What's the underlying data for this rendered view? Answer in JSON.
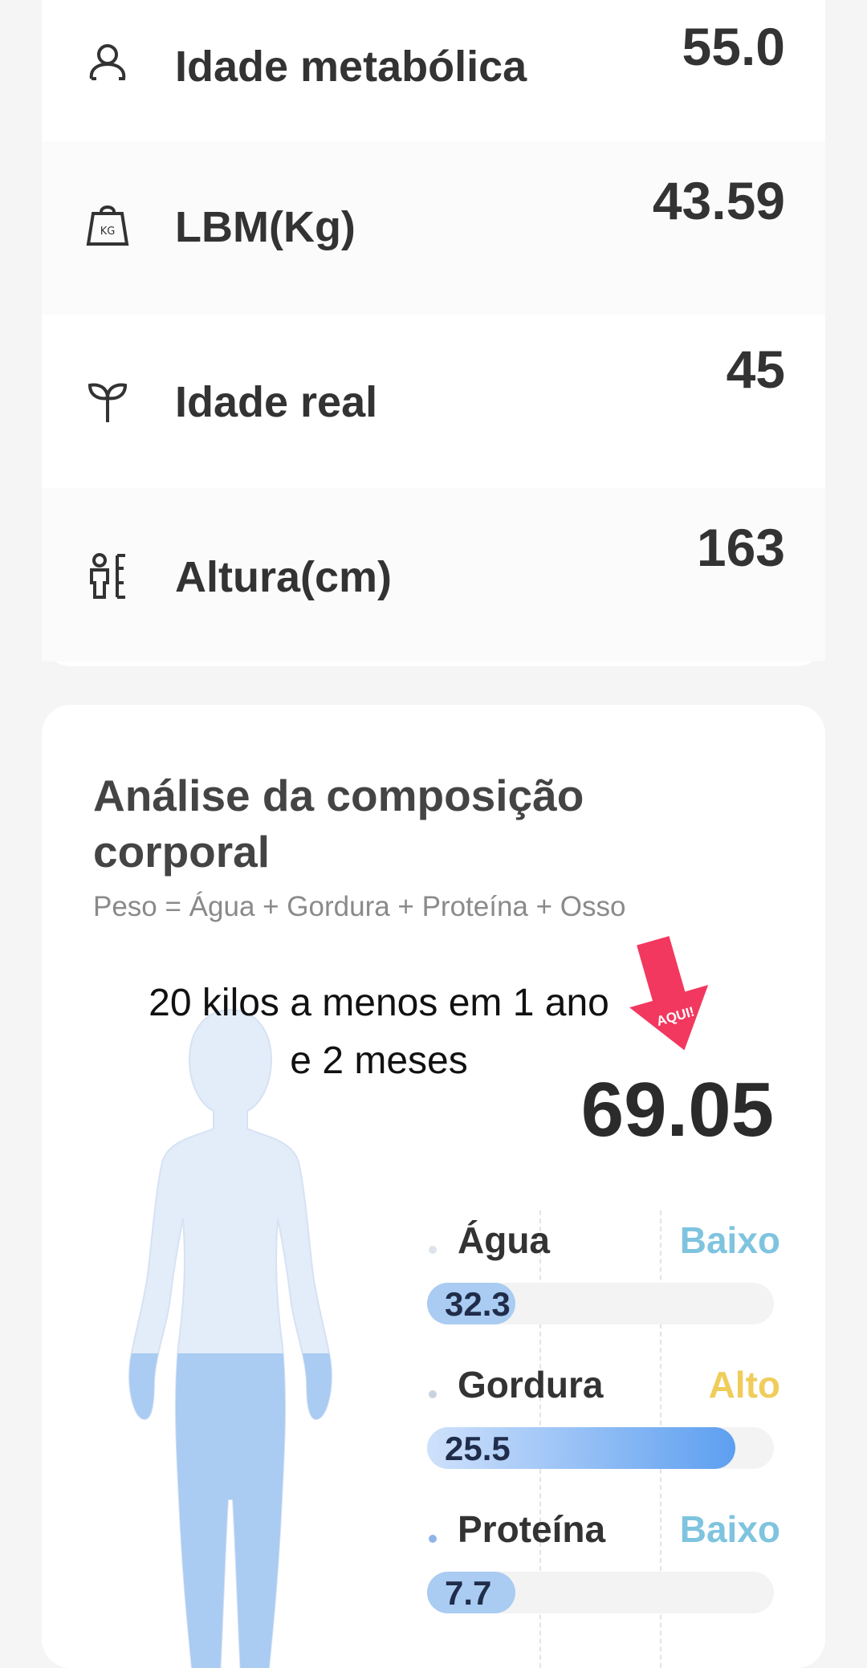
{
  "metrics": [
    {
      "label": "Idade metabólica",
      "value": "55.0",
      "icon": "person-outline-icon"
    },
    {
      "label": "LBM(Kg)",
      "value": "43.59",
      "icon": "kg-weight-icon"
    },
    {
      "label": "Idade real",
      "value": "45",
      "icon": "sprout-icon"
    },
    {
      "label": "Altura(cm)",
      "value": "163",
      "icon": "height-ruler-icon"
    }
  ],
  "analysis": {
    "title": "Análise da composição corporal",
    "subtitle": "Peso = Água + Gordura + Proteína + Osso",
    "overlay_text": "20 kilos a menos em 1 ano e 2 meses",
    "arrow_label": "AQUI!",
    "total_weight": "69.05",
    "components": [
      {
        "name": "Água",
        "value": "32.3",
        "status": "Baixo",
        "status_color": "#7fc4df",
        "fill_fraction": 0.25,
        "dot_color": "#dde3ea"
      },
      {
        "name": "Gordura",
        "value": "25.5",
        "status": "Alto",
        "status_color": "#f0cd5a",
        "fill_fraction": 0.89,
        "dot_color": "#c9d3de"
      },
      {
        "name": "Proteína",
        "value": "7.7",
        "status": "Baixo",
        "status_color": "#7fc4df",
        "fill_fraction": 0.22,
        "dot_color": "#8fb4e8"
      }
    ]
  },
  "colors": {
    "bar_gradient_start": "#cfe1fb",
    "bar_gradient_end": "#5d9ff0",
    "arrow": "#f2385f",
    "figure_light": "#e3ecf9",
    "figure_fill": "#aacbf2"
  }
}
